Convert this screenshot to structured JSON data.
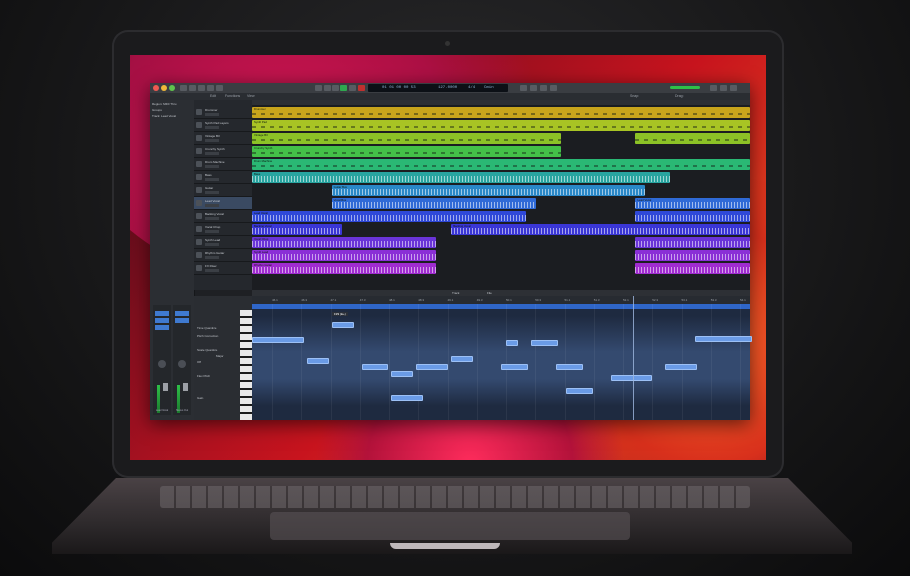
{
  "app": {
    "title": "Logic Pro",
    "lcd_position": "01 01 00 00 53",
    "lcd_sub": "45 2 3 17",
    "lcd_tempo": "127.0000",
    "lcd_sig": "4/4",
    "lcd_key": "Cmin",
    "lcd_in": "No In",
    "lcd_out": "No Out",
    "toolbar": [
      "Edit",
      "Functions",
      "View"
    ],
    "snap_label": "Snap:",
    "drag_label": "Drag:"
  },
  "inspector": {
    "rows": [
      "Region: MIDI Thru",
      "Groups",
      "Track: Lead Vocal"
    ],
    "strips": [
      {
        "label": "Lead Vocal",
        "slot1": "Setting",
        "slot2": "EQ"
      },
      {
        "label": "Stereo Out",
        "slot1": "Setting",
        "slot2": "EQ"
      }
    ]
  },
  "tracks": [
    {
      "name": "Drummer",
      "color": "#c9a51c",
      "regions": [
        {
          "s": 0,
          "e": 1,
          "label": "Drummer"
        }
      ],
      "type": "midi"
    },
    {
      "name": "Synth Pad Layers",
      "color": "#a8c424",
      "regions": [
        {
          "s": 0,
          "e": 1,
          "label": "Synth Pad"
        }
      ],
      "type": "midi"
    },
    {
      "name": "Vintage B3",
      "color": "#8cc226",
      "regions": [
        {
          "s": 0,
          "e": 0.62,
          "label": "Vintage B3"
        },
        {
          "s": 0.77,
          "e": 1,
          "label": ""
        }
      ],
      "type": "midi"
    },
    {
      "name": "Crunchy Synth",
      "color": "#44c048",
      "regions": [
        {
          "s": 0,
          "e": 0.62,
          "label": "Crunchy Synth"
        }
      ],
      "type": "midi"
    },
    {
      "name": "Drum Machine",
      "color": "#2ab874",
      "regions": [
        {
          "s": 0,
          "e": 1,
          "label": "Drum Machine"
        }
      ],
      "type": "midi"
    },
    {
      "name": "Bass",
      "color": "#28a4a0",
      "regions": [
        {
          "s": 0,
          "e": 0.84,
          "label": "Bass"
        }
      ],
      "type": "audio"
    },
    {
      "name": "Guitar",
      "color": "#2a88c8",
      "regions": [
        {
          "s": 0.16,
          "e": 0.79,
          "label": "Guitar Bus"
        }
      ],
      "type": "audio"
    },
    {
      "name": "Lead Vocal",
      "color": "#2f6ad6",
      "regions": [
        {
          "s": 0.16,
          "e": 0.57,
          "label": "Vocal Bus"
        },
        {
          "s": 0.77,
          "e": 1,
          "label": "Lead Vocal"
        }
      ],
      "type": "audio"
    },
    {
      "name": "Backing Vocal",
      "color": "#2f48d8",
      "regions": [
        {
          "s": 0,
          "e": 0.55,
          "label": "Lead Vocal"
        },
        {
          "s": 0.77,
          "e": 1,
          "label": ""
        }
      ],
      "type": "audio"
    },
    {
      "name": "Vocal Chop",
      "color": "#3a36d6",
      "regions": [
        {
          "s": 0,
          "e": 0.18,
          "label": "Backing Vocal"
        },
        {
          "s": 0.4,
          "e": 1,
          "label": "Backing Vocal"
        }
      ],
      "type": "audio"
    },
    {
      "name": "Synth Lead",
      "color": "#6a34d8",
      "regions": [
        {
          "s": 0,
          "e": 0.37,
          "label": "Vocal Chop"
        },
        {
          "s": 0.77,
          "e": 1,
          "label": ""
        }
      ],
      "type": "audio"
    },
    {
      "name": "Rhythm Guitar",
      "color": "#8a30d6",
      "regions": [
        {
          "s": 0,
          "e": 0.37,
          "label": "Synth Lead"
        },
        {
          "s": 0.77,
          "e": 1,
          "label": ""
        }
      ],
      "type": "audio"
    },
    {
      "name": "FX Riser",
      "color": "#a02cd0",
      "regions": [
        {
          "s": 0,
          "e": 0.37,
          "label": "Rhythm Guitar"
        },
        {
          "s": 0.77,
          "e": 1,
          "label": ""
        }
      ],
      "type": "audio"
    }
  ],
  "editor": {
    "tabs": [
      "Track",
      "File"
    ],
    "header_items": [
      "Time Quantize",
      "Pitch Correction",
      "Scale Quantize",
      "Major",
      "Off",
      "Flex Pitch",
      "Gain"
    ],
    "ruler_marks": [
      "46.1",
      "46.3",
      "47.1",
      "47.3",
      "48.1",
      "48.3",
      "49.1",
      "49.3",
      "50.1",
      "50.3",
      "51.1",
      "51.3",
      "52.1",
      "52.3",
      "53.1",
      "53.3",
      "54.1"
    ],
    "note_popup": "F#3 (E+)",
    "notes": [
      {
        "s": 0.0,
        "e": 0.1,
        "p": 0.22
      },
      {
        "s": 0.11,
        "e": 0.15,
        "p": 0.45
      },
      {
        "s": 0.16,
        "e": 0.2,
        "p": 0.05
      },
      {
        "s": 0.22,
        "e": 0.27,
        "p": 0.52
      },
      {
        "s": 0.28,
        "e": 0.32,
        "p": 0.6
      },
      {
        "s": 0.33,
        "e": 0.39,
        "p": 0.52
      },
      {
        "s": 0.28,
        "e": 0.34,
        "p": 0.88
      },
      {
        "s": 0.4,
        "e": 0.44,
        "p": 0.43
      },
      {
        "s": 0.5,
        "e": 0.55,
        "p": 0.52
      },
      {
        "s": 0.51,
        "e": 0.53,
        "p": 0.25
      },
      {
        "s": 0.56,
        "e": 0.61,
        "p": 0.25
      },
      {
        "s": 0.61,
        "e": 0.66,
        "p": 0.52
      },
      {
        "s": 0.63,
        "e": 0.68,
        "p": 0.8
      },
      {
        "s": 0.72,
        "e": 0.8,
        "p": 0.65
      },
      {
        "s": 0.83,
        "e": 0.89,
        "p": 0.52
      },
      {
        "s": 0.89,
        "e": 1.0,
        "p": 0.2
      }
    ],
    "playhead": 0.765
  },
  "wallpaper_colors": [
    "#e0185a",
    "#ff6a2a",
    "#b01048"
  ]
}
